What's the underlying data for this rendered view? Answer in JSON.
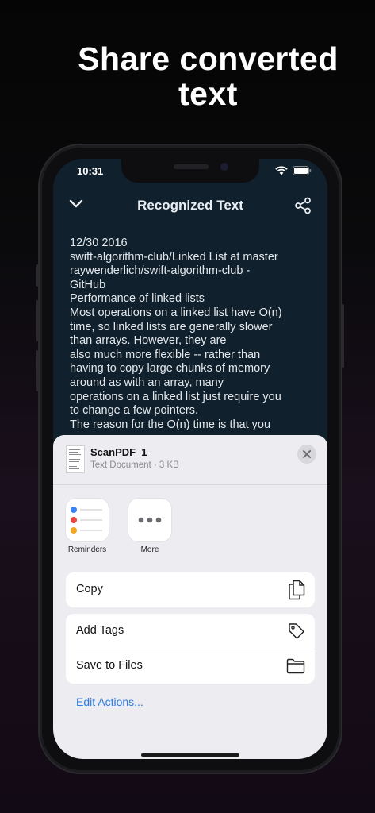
{
  "headline": {
    "line1": "Share converted",
    "line2": "text"
  },
  "status": {
    "time": "10:31"
  },
  "nav": {
    "title": "Recognized Text"
  },
  "content_lines": [
    "12/30 2016",
    "swift-algorithm-club/Linked List at master",
    "raywenderlich/swift-algorithm-club -",
    "GitHub",
    "Performance of linked lists",
    "Most operations on a linked list have O(n)",
    "time, so linked lists are generally slower",
    "than arrays. However, they are",
    "also much more flexible -- rather than",
    "having to copy large chunks of memory",
    "around as with an array, many",
    "operations on a linked list just require you",
    "to change a few pointers.",
    "The reason for the O(n) time is that you"
  ],
  "share_sheet": {
    "file_name": "ScanPDF_1",
    "file_info": "Text Document · 3 KB",
    "apps": [
      {
        "label": "Reminders",
        "icon": "reminders-icon"
      },
      {
        "label": "More",
        "icon": "more-icon"
      }
    ],
    "actions": {
      "copy": "Copy",
      "add_tags": "Add Tags",
      "save_to_files": "Save to Files"
    },
    "edit_actions": "Edit Actions..."
  },
  "colors": {
    "accent": "#2f7bdf",
    "screen_bg": "#10202c",
    "sheet_bg": "#ececf1"
  }
}
